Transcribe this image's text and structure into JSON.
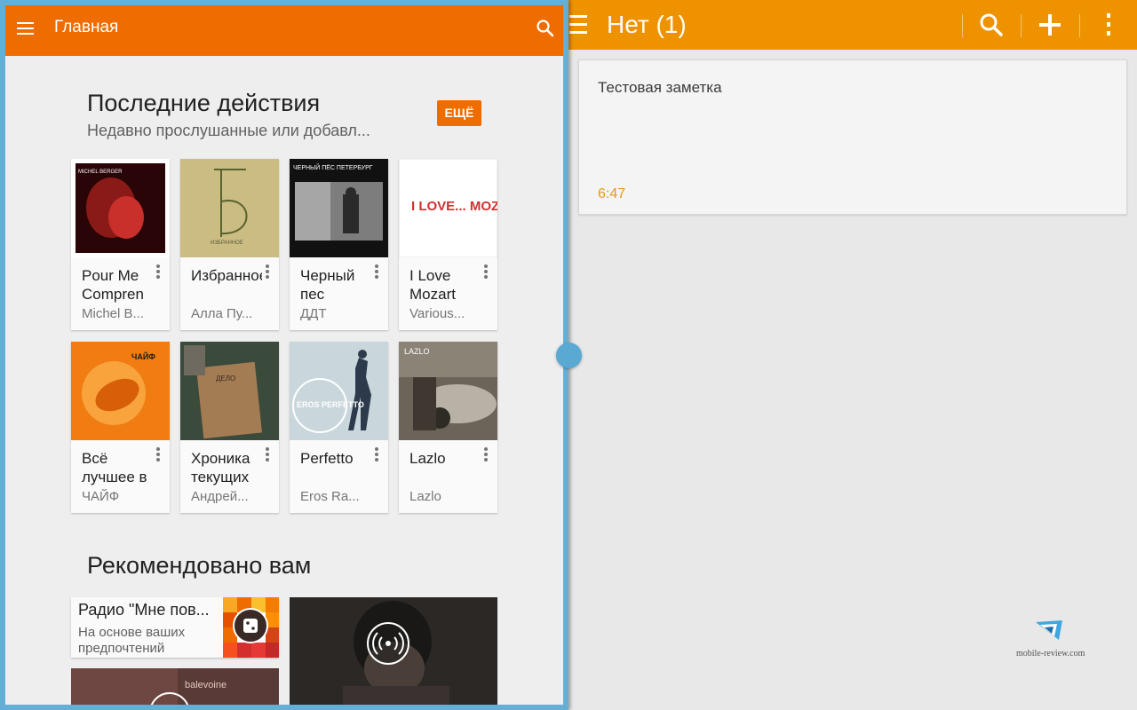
{
  "music": {
    "toolbar": {
      "title": "Главная"
    },
    "recent": {
      "title": "Последние действия",
      "subtitle": "Недавно прослушанные или добавл...",
      "more_label": "ЕЩЁ",
      "albums": [
        {
          "title": "Pour Me Compren",
          "artist": "Michel B...",
          "art_text": "MICHEL BERGER"
        },
        {
          "title": "Избранное",
          "artist": "Алла Пу...",
          "art_text": "ИЗБРАННОЕ"
        },
        {
          "title": "Черный пес",
          "artist": "ДДТ",
          "art_text": "ЧЕРНЫЙ ПЁС ПЕТЕРБУРГ"
        },
        {
          "title": "I Love Mozart",
          "artist": "Various...",
          "art_text": "I LOVE... MOZART"
        },
        {
          "title": "Всё лучшее в",
          "artist": "ЧАЙФ",
          "art_text": "ЧАЙФ"
        },
        {
          "title": "Хроника текущих",
          "artist": "Андрей...",
          "art_text": "ДЕЛО"
        },
        {
          "title": "Perfetto",
          "artist": "Eros Ra...",
          "art_text": "EROS PERFETTO"
        },
        {
          "title": "Lazlo",
          "artist": "Lazlo",
          "art_text": "LAZLO"
        }
      ]
    },
    "recommended": {
      "title": "Рекомендовано вам",
      "radio_title": "Радио \"Мне пов...",
      "radio_desc": "На основе ваших предпочтений",
      "small_art_text": "balevoine"
    }
  },
  "notes": {
    "toolbar": {
      "title": "Нет (1)"
    },
    "note": {
      "text": "Тестовая заметка",
      "time": "6:47"
    },
    "watermark": "mobile-review.com"
  },
  "colors": {
    "music_accent": "#ef6c00",
    "notes_accent": "#ee9200",
    "window_frame": "#64afd6"
  }
}
